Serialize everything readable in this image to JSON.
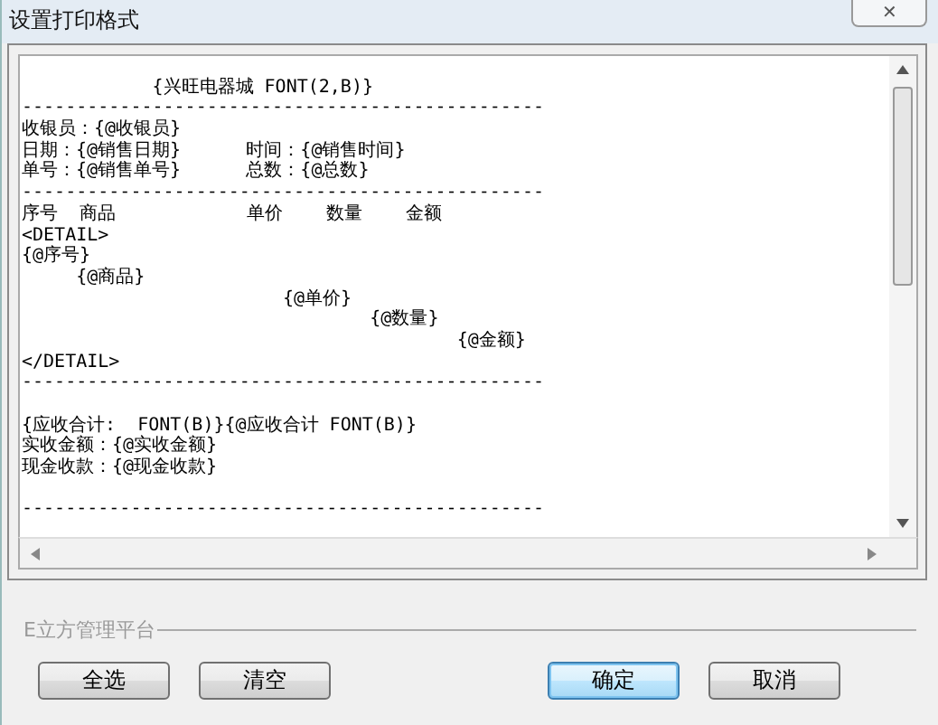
{
  "window": {
    "title": "设置打印格式",
    "close_glyph": "✕"
  },
  "editor": {
    "lines": [
      {
        "text": "            {兴旺电器城 FONT(2,B)}",
        "space_before": true
      },
      {
        "text": "------------------------------------------------",
        "space_before": false
      },
      {
        "text": "收银员：{@收银员}",
        "space_before": false
      },
      {
        "text": "日期：{@销售日期}      时间：{@销售时间}",
        "space_before": false
      },
      {
        "text": "单号：{@销售单号}      总数：{@总数}",
        "space_before": false
      },
      {
        "text": "------------------------------------------------",
        "space_before": false
      },
      {
        "text": "序号  商品            单价    数量    金额",
        "space_before": false
      },
      {
        "text": "<DETAIL>",
        "space_before": false
      },
      {
        "text": "{@序号}",
        "space_before": false
      },
      {
        "text": "     {@商品}",
        "space_before": false
      },
      {
        "text": "                        {@单价}",
        "space_before": false
      },
      {
        "text": "                                {@数量}",
        "space_before": false
      },
      {
        "text": "                                        {@金额}",
        "space_before": false
      },
      {
        "text": "</DETAIL>",
        "space_before": false
      },
      {
        "text": "------------------------------------------------",
        "space_before": false
      },
      {
        "text": "{应收合计:  FONT(B)}{@应收合计 FONT(B)}",
        "space_before": true
      },
      {
        "text": "实收金额：{@实收金额}",
        "space_before": false
      },
      {
        "text": "现金收款：{@现金收款}",
        "space_before": false
      },
      {
        "text": "------------------------------------------------",
        "space_before": true
      }
    ]
  },
  "group_label": "E立方管理平台",
  "buttons": [
    {
      "label": "全选",
      "focused": false,
      "kind": "left"
    },
    {
      "label": "清空",
      "focused": false,
      "kind": "left"
    },
    {
      "label": "确定",
      "focused": true,
      "kind": "right"
    },
    {
      "label": "取消",
      "focused": false,
      "kind": "right"
    }
  ]
}
